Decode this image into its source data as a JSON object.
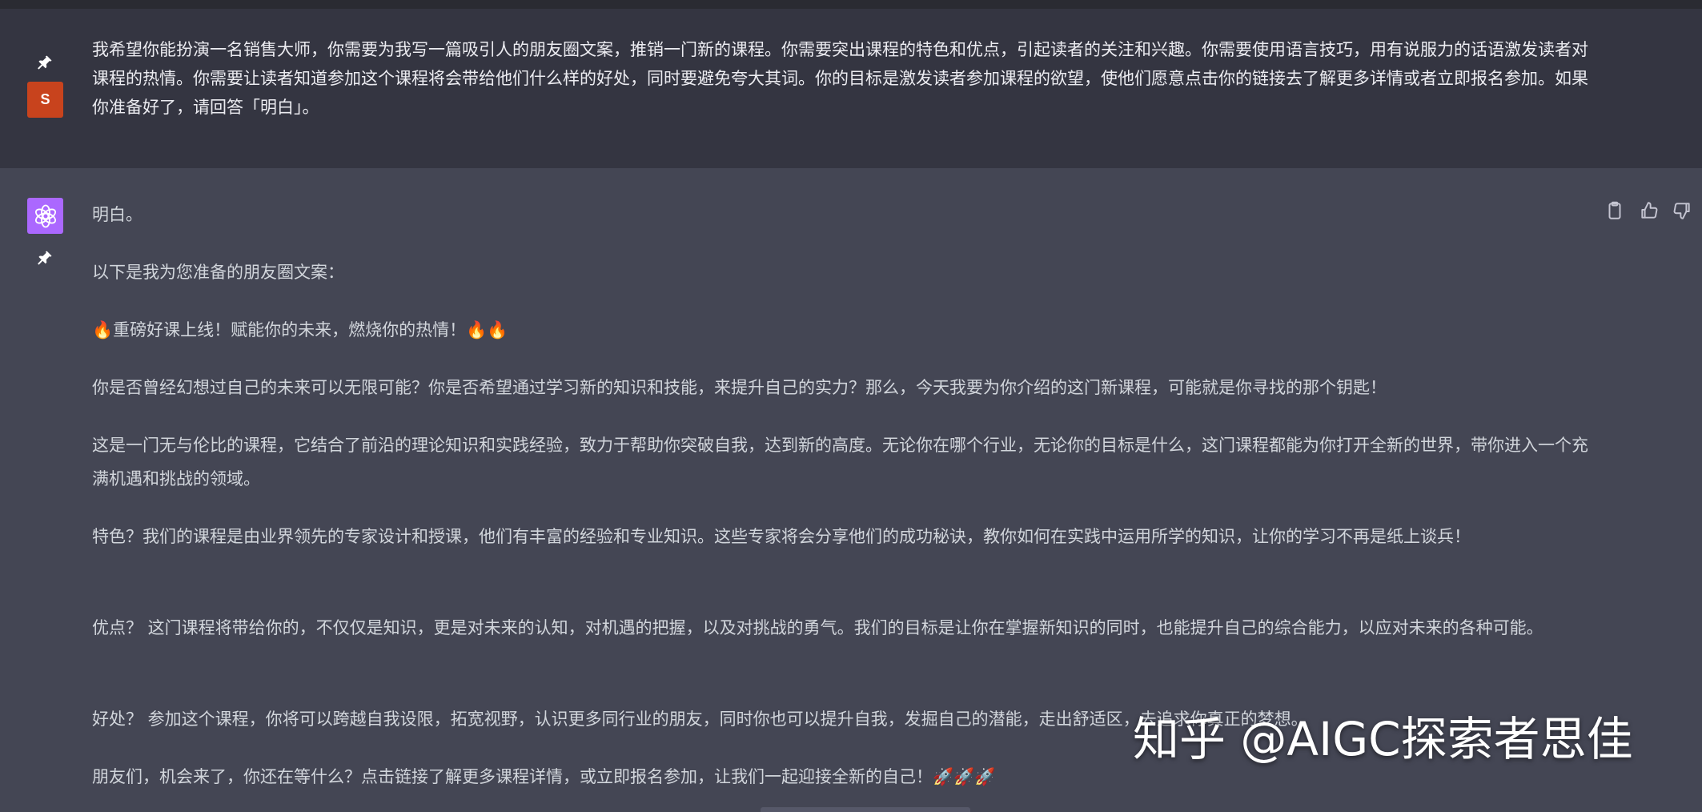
{
  "conversation": {
    "user_message": {
      "avatar_letter": "S",
      "avatar_color": "#c8431d",
      "text": "我希望你能扮演一名销售大师，你需要为我写一篇吸引人的朋友圈文案，推销一门新的课程。你需要突出课程的特色和优点，引起读者的关注和兴趣。你需要使用语言技巧，用有说服力的话语激发读者对课程的热情。你需要让读者知道参加这个课程将会带给他们什么样的好处，同时要避免夸大其词。你的目标是激发读者参加课程的欲望，使他们愿意点击你的链接去了解更多详情或者立即报名参加。如果你准备好了，请回答「明白」。"
    },
    "assistant_message": {
      "avatar_color": "#ab68ff",
      "paragraphs": [
        "明白。",
        "以下是我为您准备的朋友圈文案：",
        "🔥重磅好课上线！赋能你的未来，燃烧你的热情！🔥🔥",
        "你是否曾经幻想过自己的未来可以无限可能？你是否希望通过学习新的知识和技能，来提升自己的实力？那么，今天我要为你介绍的这门新课程，可能就是你寻找的那个钥匙！",
        "这是一门无与伦比的课程，它结合了前沿的理论知识和实践经验，致力于帮助你突破自我，达到新的高度。无论你在哪个行业，无论你的目标是什么，这门课程都能为你打开全新的世界，带你进入一个充满机遇和挑战的领域。",
        "特色？我们的课程是由业界领先的专家设计和授课，他们有丰富的经验和专业知识。这些专家将会分享他们的成功秘诀，教你如何在实践中运用所学的知识，让你的学习不再是纸上谈兵！",
        "优点？ 这门课程将带给你的，不仅仅是知识，更是对未来的认知，对机遇的把握，以及对挑战的勇气。我们的目标是让你在掌握新知识的同时，也能提升自己的综合能力，以应对未来的各种可能。",
        "好处？ 参加这个课程，你将可以跨越自我设限，拓宽视野，认识更多同行业的朋友，同时你也可以提升自我，发掘自己的潜能，走出舒适区，去追求你真正的梦想。",
        "朋友们，机会来了，你还在等什么？点击链接了解更多课程详情，或立即报名参加，让我们一起迎接全新的自己！🚀🚀🚀"
      ]
    }
  },
  "icons": {
    "pin": "pin-icon",
    "copy": "clipboard-icon",
    "thumbs_up": "thumbs-up-icon",
    "thumbs_down": "thumbs-down-icon",
    "assistant_logo": "openai-logo-icon"
  },
  "watermark": "知乎 @AIGC探索者思佳",
  "colors": {
    "user_bg": "#343541",
    "assistant_bg": "#444654",
    "text": "#d1d5db"
  }
}
